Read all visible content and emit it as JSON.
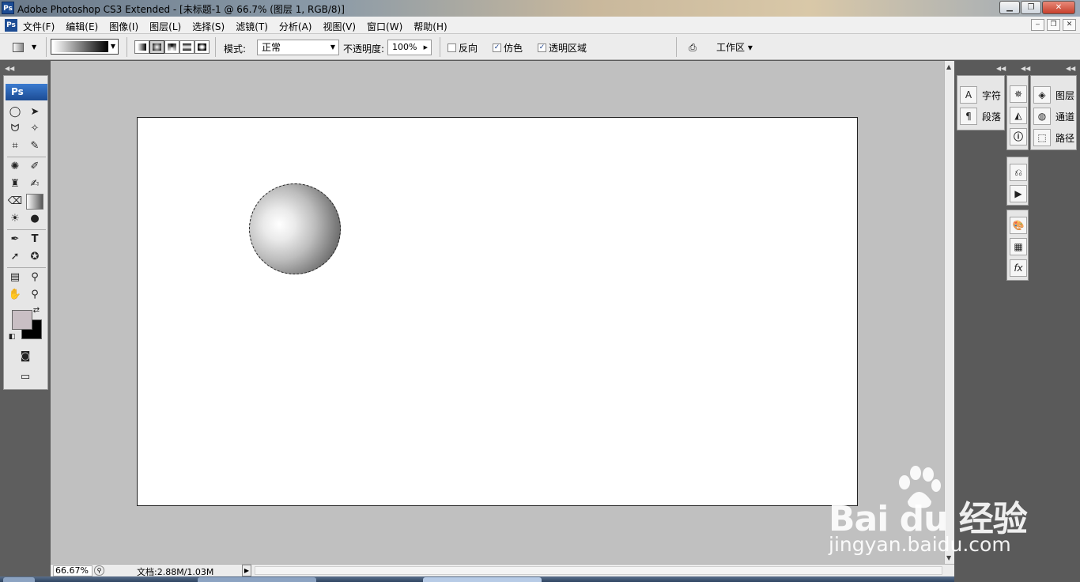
{
  "window": {
    "title": "Adobe Photoshop CS3 Extended - [未标题-1 @ 66.7% (图层 1, RGB/8)]",
    "app_icon": "Ps",
    "buttons": [
      "minimize",
      "restore",
      "close"
    ]
  },
  "menubar": {
    "items": [
      "文件(F)",
      "编辑(E)",
      "图像(I)",
      "图层(L)",
      "选择(S)",
      "滤镜(T)",
      "分析(A)",
      "视图(V)",
      "窗口(W)",
      "帮助(H)"
    ]
  },
  "options": {
    "mode_label": "模式:",
    "mode_value": "正常",
    "opacity_label": "不透明度:",
    "opacity_value": "100%",
    "reverse_label": "反向",
    "reverse_checked": false,
    "dither_label": "仿色",
    "dither_checked": true,
    "transparency_label": "透明区域",
    "transparency_checked": true,
    "workspace_label": "工作区 ▾",
    "gradient_types": [
      "linear",
      "radial",
      "angle",
      "reflected",
      "diamond"
    ],
    "active_gradient_type": "radial"
  },
  "toolbox": {
    "header": "Ps",
    "foreground_color": "#c9bfc4",
    "background_color": "#000000"
  },
  "document": {
    "background": "#ffffff",
    "object": "radial-gradient sphere with marching-ants selection"
  },
  "statusbar": {
    "zoom": "66.67%",
    "doc_info": "文档:2.88M/1.03M"
  },
  "panels": {
    "group1": [
      "字符",
      "段落"
    ],
    "group3": [
      "图层",
      "通道",
      "路径"
    ]
  },
  "watermark": {
    "line1": "Bai du 经验",
    "line2": "jingyan.baidu.com"
  },
  "colors": {
    "canvas_bg": "#c0c0c0",
    "chrome_bg": "#ececec",
    "accent": "#1c4c94"
  }
}
